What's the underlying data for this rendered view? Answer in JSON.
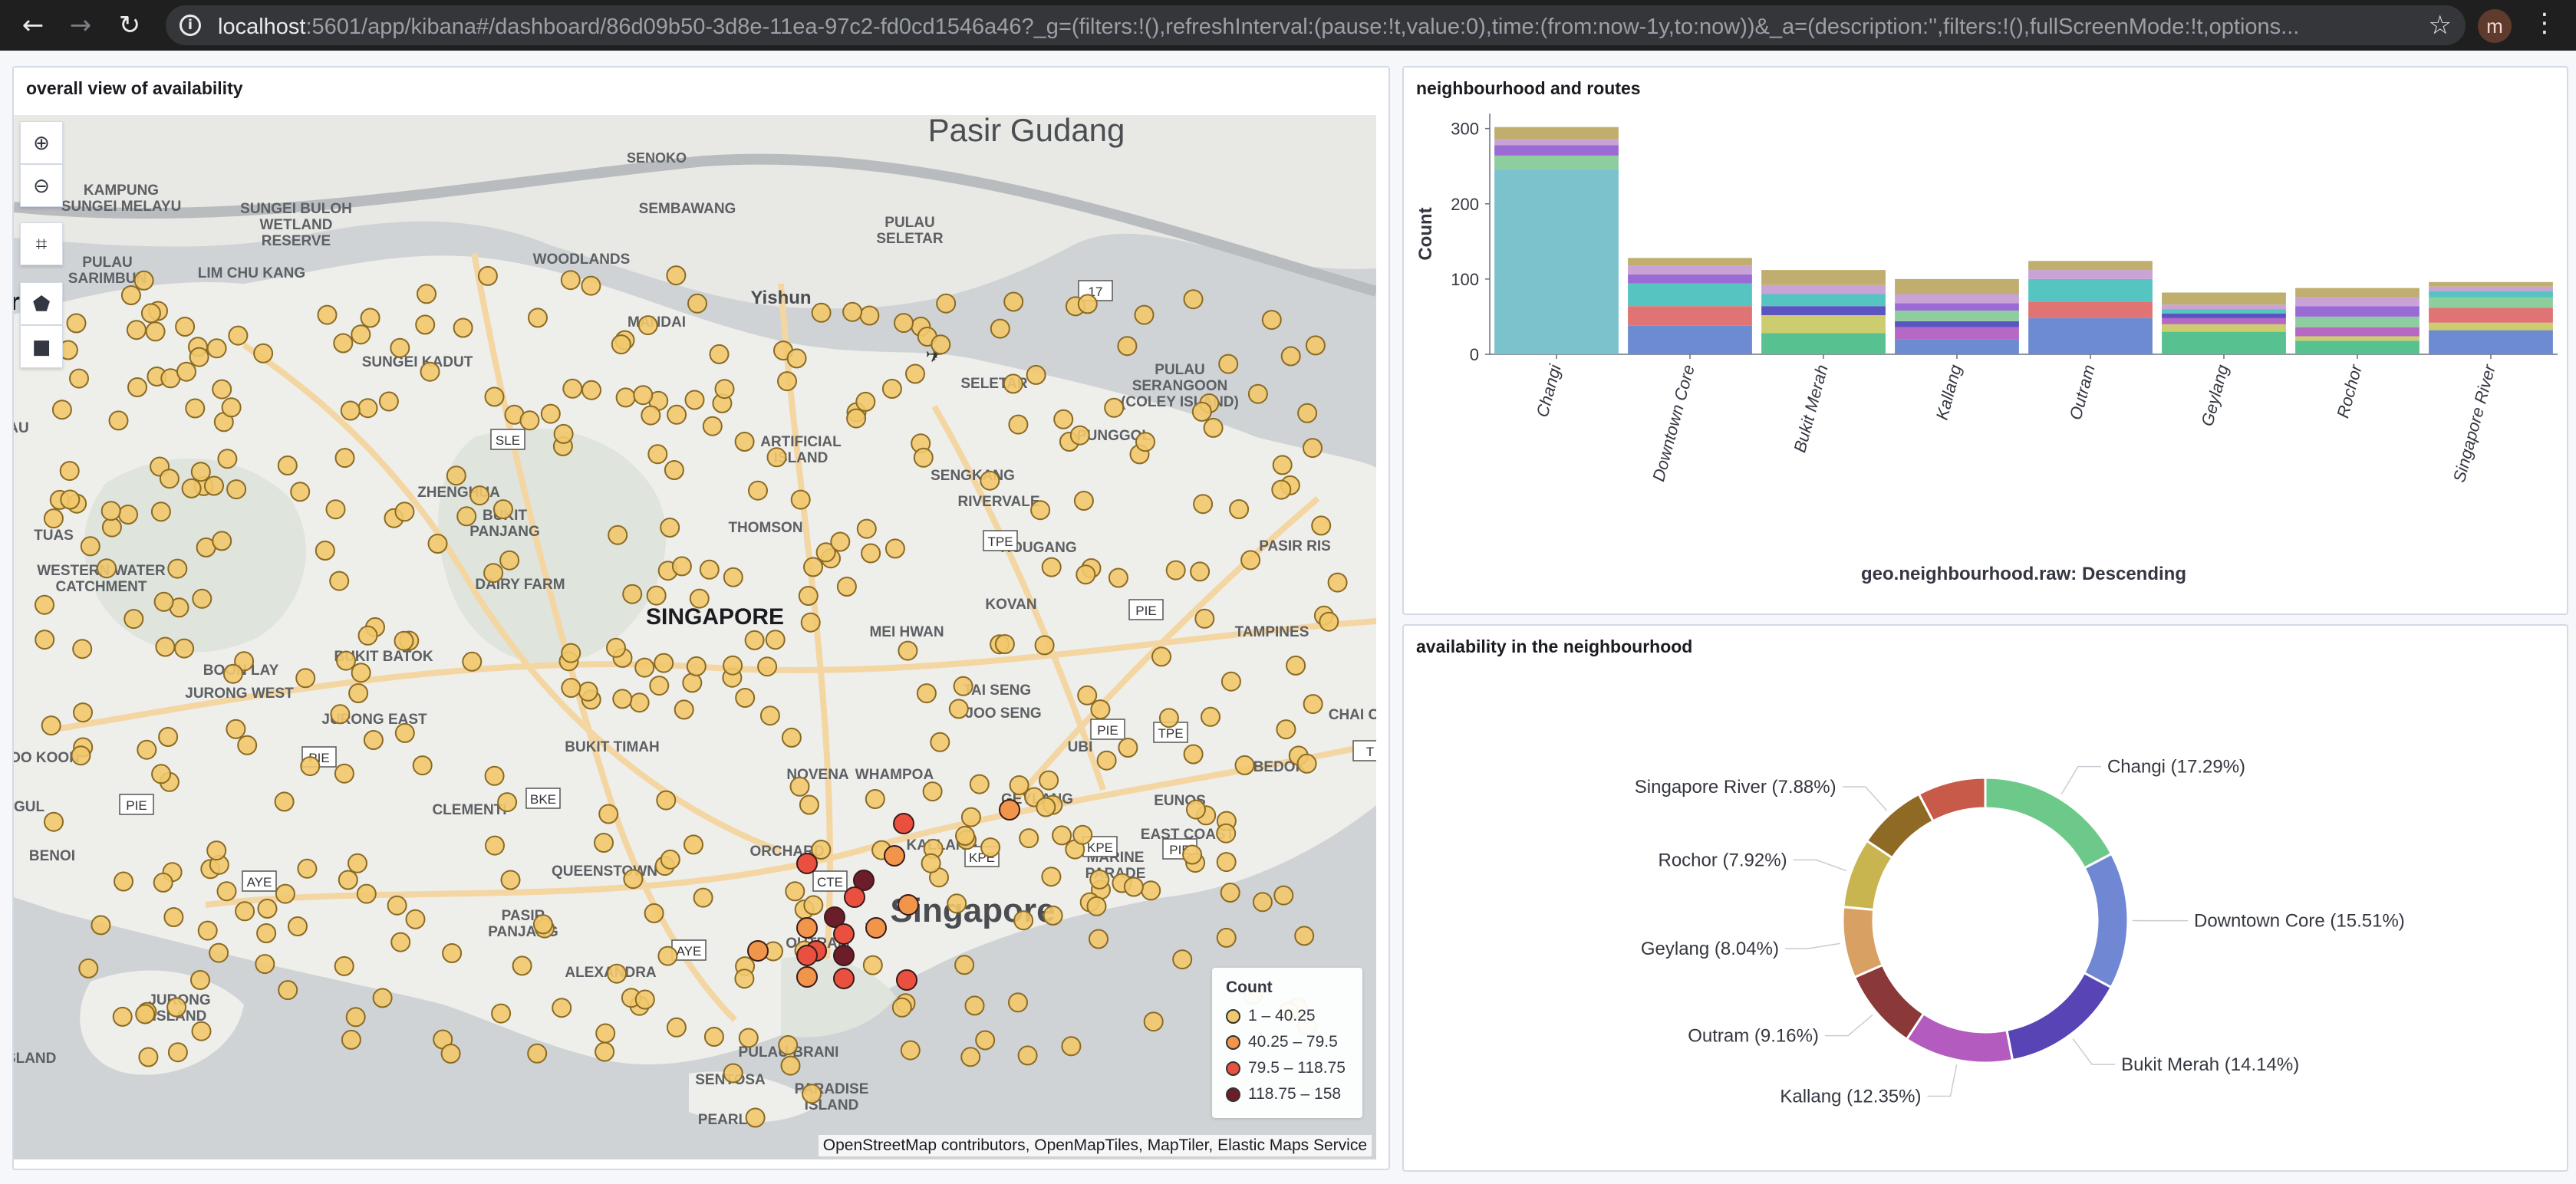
{
  "browser": {
    "url_host": "localhost",
    "url_rest": ":5601/app/kibana#/dashboard/86d09b50-3d8e-11ea-97c2-fd0cd1546a46?_g=(filters:!(),refreshInterval:(pause:!t,value:0),time:(from:now-1y,to:now))&_a=(description:'',filters:!(),fullScreenMode:!t,options...",
    "profile_initial": "m",
    "icons": [
      "back-arrow-icon",
      "forward-arrow-icon",
      "reload-icon",
      "info-icon",
      "star-icon",
      "kebab-menu-icon"
    ]
  },
  "map_panel": {
    "title": "overall view of availability",
    "legend": {
      "title": "Count",
      "items": [
        {
          "label": "1 – 40.25",
          "color": "#f1c86b"
        },
        {
          "label": "40.25 – 79.5",
          "color": "#f0954a"
        },
        {
          "label": "79.5 – 118.75",
          "color": "#e9503f"
        },
        {
          "label": "118.75 – 158",
          "color": "#6b1d2a"
        }
      ]
    },
    "attribution": "OpenStreetMap contributors, OpenMapTiles, MapTiler, Elastic Maps Service",
    "place_labels": {
      "pasir_gudang": "Pasir Gudang",
      "senoko": "SENOKO",
      "kampung": "KAMPUNG\nSUNGEI MELAYU",
      "sungei_buloh": "SUNGEI BULOH\nWETLAND\nRESERVE",
      "pulau_sarimbun": "PULAU\nSARIMBUN",
      "lim_chu_kang": "LIM CHU KANG",
      "sembawang": "SEMBAWANG",
      "woodlands": "WOODLANDS",
      "yishun": "Yishun",
      "pulau_seletar": "PULAU\nSELETAR",
      "mandai": "MANDAI",
      "sungei_kadut": "SUNGEI KADUT",
      "seletar": "SELETAR",
      "pulau_serangoon": "PULAU\nSERANGOON\n(COLEY ISLAND)",
      "artificial_island": "ARTIFICIAL\nISLAND",
      "punggol": "PUNGGOL",
      "sengkang": "SENGKANG",
      "rivervale": "RIVERVALE",
      "zhenghua": "ZHENGHUA",
      "bukit_panjang": "BUKIT\nPANJANG",
      "thomson": "THOMSON",
      "hougang": "HOUGANG",
      "pasir_ris": "PASIR RIS",
      "western_water_catchment": "WESTERN WATER\nCATCHMENT",
      "dairy_farm": "DAIRY FARM",
      "singapore_upper": "SINGAPORE",
      "mei_hwan": "MEI HWAN",
      "kovan": "KOVAN",
      "tampines": "TAMPINES",
      "boon_lay": "BOON LAY",
      "jurong_west": "JURONG WEST",
      "bukit_batok": "BUKIT BATOK",
      "jurong_east": "JURONG EAST",
      "tai_seng": "TAI SENG",
      "joo_seng": "JOO SENG",
      "bukit_timah": "BUKIT TIMAH",
      "ubi": "UBI",
      "chai_chee": "CHAI CHEE",
      "tuas": "TUAS",
      "novena": "NOVENA",
      "whampoa": "WHAMPOA",
      "bedok": "BEDOK",
      "geylang": "GEYLANG",
      "eunos": "EUNOS",
      "clementi": "CLEMENTI",
      "gul": "GUL",
      "benoi": "BENOI",
      "orchard": "ORCHARD",
      "kallang": "KALLANG",
      "east_coast": "EAST COAST",
      "queenstown": "QUEENSTOWN",
      "marine_parade": "MARINE\nPARADE",
      "pasir_panjang": "PASIR\nPANJANG",
      "singapore_city": "Singapore",
      "outram": "OUTRAM",
      "alexandra": "ALEXANDRA",
      "jurong_island": "JURONG\nISLAND",
      "pulau_brani": "PULAU BRANI",
      "sentosa": "SENTOSA",
      "paradise_island": "PARADISE\nISLAND",
      "pearl": "PEARL",
      "ori": "ri",
      "au": "AU",
      "oo_koon": "OO KOON",
      "island": "ISLAND"
    },
    "road_shields": [
      "17",
      "SLE",
      "TPE",
      "PIE",
      "BKE",
      "PIE",
      "PIE",
      "PIE",
      "KPE",
      "TPE",
      "AYE",
      "CTE",
      "KPE",
      "AYE",
      "PIE",
      "T"
    ]
  },
  "bar_panel": {
    "title": "neighbourhood and routes"
  },
  "pie_panel": {
    "title": "availability in the neighbourhood"
  },
  "chart_data": [
    {
      "type": "bar",
      "stacked": true,
      "title": "neighbourhood and routes",
      "xlabel": "geo.neighbourhood.raw: Descending",
      "ylabel": "Count",
      "ylim": [
        0,
        320
      ],
      "yticks": [
        0,
        100,
        200,
        300
      ],
      "categories": [
        "Changi",
        "Downtown Core",
        "Bukit Merah",
        "Kallang",
        "Outram",
        "Geylang",
        "Rochor",
        "Singapore River"
      ],
      "series": [
        {
          "color": "#7cc2cd",
          "values": [
            246,
            0,
            0,
            0,
            0,
            0,
            0,
            0
          ]
        },
        {
          "color": "#6d8bd0",
          "values": [
            0,
            38,
            0,
            20,
            48,
            0,
            0,
            32
          ]
        },
        {
          "color": "#57c18f",
          "values": [
            0,
            0,
            28,
            0,
            0,
            30,
            18,
            0
          ]
        },
        {
          "color": "#cdcc6f",
          "values": [
            0,
            0,
            24,
            0,
            0,
            10,
            6,
            10
          ]
        },
        {
          "color": "#e07373",
          "values": [
            0,
            26,
            0,
            0,
            22,
            0,
            0,
            20
          ]
        },
        {
          "color": "#b568c4",
          "values": [
            0,
            0,
            0,
            16,
            0,
            8,
            12,
            0
          ]
        },
        {
          "color": "#5a55c0",
          "values": [
            0,
            0,
            12,
            8,
            0,
            6,
            0,
            0
          ]
        },
        {
          "color": "#8dcd9e",
          "values": [
            18,
            0,
            0,
            14,
            0,
            0,
            14,
            14
          ]
        },
        {
          "color": "#56c4c0",
          "values": [
            0,
            30,
            16,
            0,
            30,
            6,
            0,
            8
          ]
        },
        {
          "color": "#9b6bd5",
          "values": [
            14,
            12,
            0,
            10,
            0,
            0,
            14,
            0
          ]
        },
        {
          "color": "#c9a3d6",
          "values": [
            8,
            12,
            12,
            12,
            12,
            6,
            12,
            6
          ]
        },
        {
          "color": "#bfae6d",
          "values": [
            16,
            10,
            20,
            20,
            12,
            16,
            12,
            6
          ]
        }
      ]
    },
    {
      "type": "pie",
      "donut": true,
      "title": "availability in the neighbourhood",
      "slices": [
        {
          "label": "Changi (17.29%)",
          "value": 17.29,
          "color": "#6dc98a"
        },
        {
          "label": "Downtown Core (15.51%)",
          "value": 15.51,
          "color": "#7088d4"
        },
        {
          "label": "Bukit Merah (14.14%)",
          "value": 14.14,
          "color": "#5844b5"
        },
        {
          "label": "Kallang (12.35%)",
          "value": 12.35,
          "color": "#b35bbf"
        },
        {
          "label": "Outram (9.16%)",
          "value": 9.16,
          "color": "#8b3838"
        },
        {
          "label": "Geylang (8.04%)",
          "value": 8.04,
          "color": "#d9a064"
        },
        {
          "label": "Rochor (7.92%)",
          "value": 7.92,
          "color": "#c8b54f"
        },
        {
          "label": "Singapore River (7.88%)",
          "value": 7.88,
          "color": "#8e6a24"
        },
        {
          "label": "",
          "value": 7.71,
          "color": "#c85a4a"
        }
      ]
    }
  ]
}
